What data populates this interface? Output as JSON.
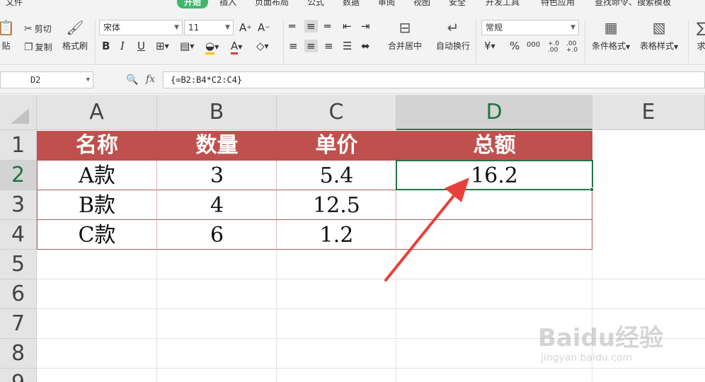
{
  "ribbon": {
    "tabs": [
      "文件",
      "开始",
      "插入",
      "页面布局",
      "公式",
      "数据",
      "审阅",
      "视图",
      "安全",
      "开发工具",
      "特色应用",
      "查找命令、搜索模板"
    ],
    "paste_label": "贴",
    "cut_label": "剪切",
    "copy_label": "复制",
    "format_painter_label": "格式刷",
    "font_name": "宋体",
    "font_size": "11",
    "merge_center_label": "合并居中",
    "wrap_text_label": "自动换行",
    "number_format": "常规",
    "conditional_format_label": "条件格式",
    "table_style_label": "表格样式",
    "percent_symbol": "%",
    "thousands_label": "000",
    "inc_decimal_label": "+.0 .00",
    "dec_decimal_label": ".00 +.0",
    "more_label": "求"
  },
  "formula_bar": {
    "name_box": "D2",
    "fx": "fx",
    "formula": "{=B2:B4*C2:C4}"
  },
  "sheet": {
    "columns": [
      "A",
      "B",
      "C",
      "D",
      "E"
    ],
    "rows": [
      "1",
      "2",
      "3",
      "4",
      "5",
      "6",
      "7",
      "8",
      "9"
    ],
    "header": [
      "名称",
      "数量",
      "单价",
      "总额"
    ],
    "data": [
      [
        "A款",
        "3",
        "5.4",
        "16.2"
      ],
      [
        "B款",
        "4",
        "12.5",
        ""
      ],
      [
        "C款",
        "6",
        "1.2",
        ""
      ]
    ],
    "active_cell": "D2"
  },
  "colors": {
    "header_fill": "#c0504d",
    "selection": "#217346",
    "annotation_arrow": "#e8403a"
  },
  "watermark": {
    "main": "Baidu经验",
    "sub": "jingyan.baidu.com"
  }
}
